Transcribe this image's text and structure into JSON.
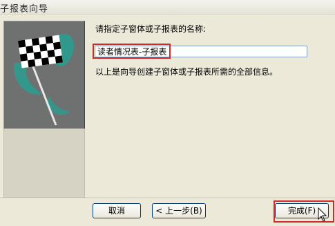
{
  "window": {
    "title": "子报表向导"
  },
  "main": {
    "prompt": "请指定子窗体或子报表的名称:",
    "name_value": "读者情况表-子报表",
    "info_text": "以上是向导创建子窗体或子报表所需的全部信息。"
  },
  "buttons": {
    "cancel": "取消",
    "back": "< 上一步(B)",
    "finish": "完成(F)"
  },
  "colors": {
    "highlight": "#d12a2a",
    "accent": "#3fa89a"
  }
}
